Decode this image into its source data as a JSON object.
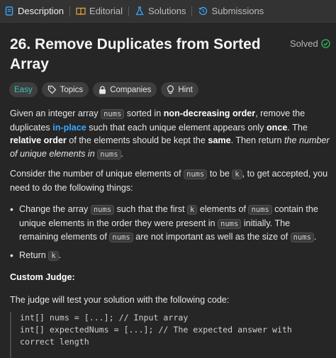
{
  "tabs": [
    {
      "label": "Description",
      "icon": "document-icon",
      "active": true
    },
    {
      "label": "Editorial",
      "icon": "book-icon",
      "active": false
    },
    {
      "label": "Solutions",
      "icon": "flask-icon",
      "active": false
    },
    {
      "label": "Submissions",
      "icon": "history-icon",
      "active": false
    }
  ],
  "problem": {
    "title": "26. Remove Duplicates from Sorted Array",
    "status": "Solved",
    "tags": [
      {
        "label": "Easy"
      },
      {
        "label": "Topics",
        "icon": "tag-icon"
      },
      {
        "label": "Companies",
        "icon": "lock-icon"
      },
      {
        "label": "Hint",
        "icon": "lightbulb-icon"
      }
    ]
  },
  "description": {
    "p1": {
      "t1": "Given an integer array ",
      "c1": "nums",
      "t2": " sorted in ",
      "b1": "non-decreasing order",
      "t3": ", remove the duplicates ",
      "link": "in-place",
      "t4": " such that each unique element appears only ",
      "b2": "once",
      "t5": ". The ",
      "b3": "relative order",
      "t6": " of the elements should be kept the ",
      "b4": "same",
      "t7": ". Then return ",
      "i1": "the number of unique elements in ",
      "c2": "nums",
      "t8": "."
    },
    "p2": {
      "t1": "Consider the number of unique elements of ",
      "c1": "nums",
      "t2": " to be ",
      "c2": "k",
      "t3": ", to get accepted, you need to do the following things:"
    },
    "bullet1": {
      "t1": "Change the array ",
      "c1": "nums",
      "t2": " such that the first ",
      "c2": "k",
      "t3": " elements of ",
      "c3": "nums",
      "t4": " contain the unique elements in the order they were present in ",
      "c4": "nums",
      "t5": " initially. The remaining elements of ",
      "c5": "nums",
      "t6": " are not important as well as the size of ",
      "c6": "nums",
      "t7": "."
    },
    "bullet2": {
      "t1": "Return ",
      "c1": "k",
      "t2": "."
    },
    "custom_judge": "Custom Judge:",
    "judge_text": "The judge will test your solution with the following code:",
    "code": "int[] nums = [...]; // Input array\nint[] expectedNums = [...]; // The expected answer with\ncorrect length"
  },
  "colors": {
    "accent_blue": "#3aa7ff",
    "easy": "#3bc4b5",
    "solved_check": "#2cbb5d"
  }
}
